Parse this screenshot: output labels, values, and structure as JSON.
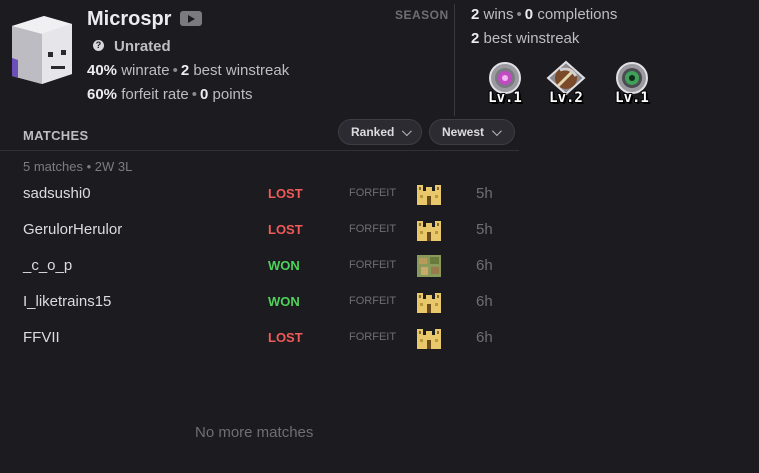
{
  "profile": {
    "username": "Microspr",
    "rank": "Unrated",
    "winrate_value": "40%",
    "winrate_label": "winrate",
    "best_streak_value": "2",
    "best_streak_label": "best winstreak",
    "forfeit_value": "60%",
    "forfeit_label": "forfeit rate",
    "points_value": "0",
    "points_label": "points"
  },
  "season": {
    "label": "SEASON",
    "wins_value": "2",
    "wins_label": "wins",
    "completions_value": "0",
    "completions_label": "completions",
    "best_streak_value": "2",
    "best_streak_label": "best winstreak",
    "achievements": [
      {
        "icon": "ender-eye-icon",
        "level": "Lv.1"
      },
      {
        "icon": "pickaxe-icon",
        "level": "Lv.2"
      },
      {
        "icon": "green-eye-icon",
        "level": "Lv.1"
      }
    ]
  },
  "matches": {
    "title": "MATCHES",
    "filter_label": "Ranked",
    "sort_label": "Newest",
    "summary": "5 matches • 2W 3L",
    "rows": [
      {
        "opponent": "sadsushi0",
        "result": "LOST",
        "type": "FORFEIT",
        "seed": "desert-temple-icon",
        "time": "5h"
      },
      {
        "opponent": "GerulorHerulor",
        "result": "LOST",
        "type": "FORFEIT",
        "seed": "desert-temple-icon",
        "time": "5h"
      },
      {
        "opponent": "_c_o_p",
        "result": "WON",
        "type": "FORFEIT",
        "seed": "village-icon",
        "time": "6h"
      },
      {
        "opponent": "I_liketrains15",
        "result": "WON",
        "type": "FORFEIT",
        "seed": "desert-temple-icon",
        "time": "6h"
      },
      {
        "opponent": "FFVII",
        "result": "LOST",
        "type": "FORFEIT",
        "seed": "desert-temple-icon",
        "time": "6h"
      }
    ],
    "empty_text": "No more matches"
  },
  "colors": {
    "background": "#1c1b1f",
    "lost": "#f05a5a",
    "won": "#4ed25a",
    "muted": "#6e6e75"
  }
}
